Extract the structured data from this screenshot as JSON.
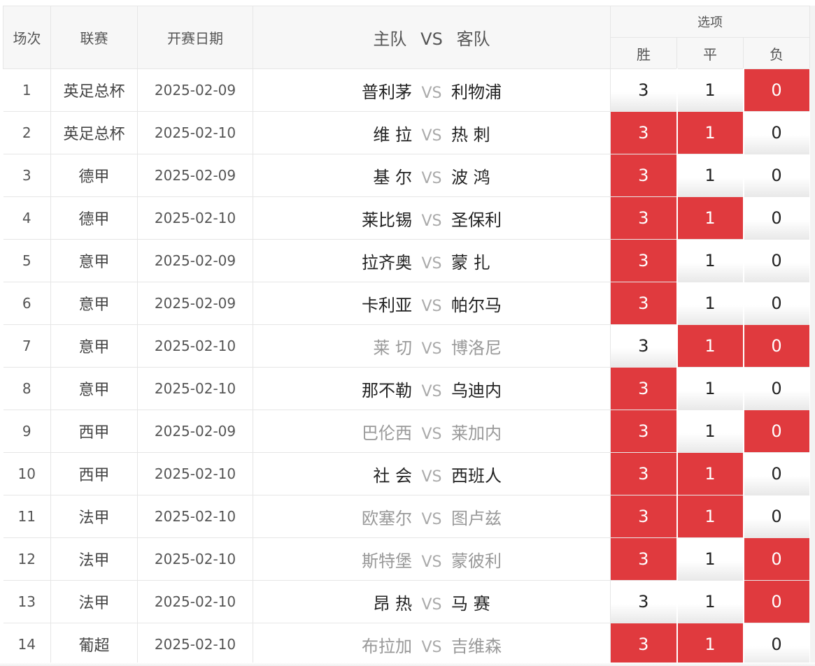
{
  "header": {
    "col_no": "场次",
    "col_league": "联赛",
    "col_date": "开赛日期",
    "col_match_home": "主队",
    "col_match_vs": "VS",
    "col_match_away": "客队",
    "col_options": "选项",
    "opt_win": "胜",
    "opt_draw": "平",
    "opt_lose": "负"
  },
  "colors": {
    "selected": "#e03a3e",
    "unselected": "#f2f2f2"
  },
  "rows": [
    {
      "no": "1",
      "league": "英足总杯",
      "date": "2025-02-09",
      "home": "普利茅",
      "vs": "VS",
      "away": "利物浦",
      "win": "3",
      "draw": "1",
      "lose": "0",
      "win_on": false,
      "draw_on": false,
      "lose_on": true,
      "dim": false
    },
    {
      "no": "2",
      "league": "英足总杯",
      "date": "2025-02-10",
      "home": "维 拉",
      "vs": "VS",
      "away": "热 刺",
      "win": "3",
      "draw": "1",
      "lose": "0",
      "win_on": true,
      "draw_on": true,
      "lose_on": false,
      "dim": false
    },
    {
      "no": "3",
      "league": "德甲",
      "date": "2025-02-09",
      "home": "基 尔",
      "vs": "VS",
      "away": "波 鸿",
      "win": "3",
      "draw": "1",
      "lose": "0",
      "win_on": true,
      "draw_on": false,
      "lose_on": false,
      "dim": false
    },
    {
      "no": "4",
      "league": "德甲",
      "date": "2025-02-10",
      "home": "莱比锡",
      "vs": "VS",
      "away": "圣保利",
      "win": "3",
      "draw": "1",
      "lose": "0",
      "win_on": true,
      "draw_on": true,
      "lose_on": false,
      "dim": false
    },
    {
      "no": "5",
      "league": "意甲",
      "date": "2025-02-09",
      "home": "拉齐奥",
      "vs": "VS",
      "away": "蒙 扎",
      "win": "3",
      "draw": "1",
      "lose": "0",
      "win_on": true,
      "draw_on": false,
      "lose_on": false,
      "dim": false
    },
    {
      "no": "6",
      "league": "意甲",
      "date": "2025-02-09",
      "home": "卡利亚",
      "vs": "VS",
      "away": "帕尔马",
      "win": "3",
      "draw": "1",
      "lose": "0",
      "win_on": true,
      "draw_on": false,
      "lose_on": false,
      "dim": false
    },
    {
      "no": "7",
      "league": "意甲",
      "date": "2025-02-10",
      "home": "莱 切",
      "vs": "VS",
      "away": "博洛尼",
      "win": "3",
      "draw": "1",
      "lose": "0",
      "win_on": false,
      "draw_on": true,
      "lose_on": true,
      "dim": true
    },
    {
      "no": "8",
      "league": "意甲",
      "date": "2025-02-10",
      "home": "那不勒",
      "vs": "VS",
      "away": "乌迪内",
      "win": "3",
      "draw": "1",
      "lose": "0",
      "win_on": true,
      "draw_on": false,
      "lose_on": false,
      "dim": false
    },
    {
      "no": "9",
      "league": "西甲",
      "date": "2025-02-09",
      "home": "巴伦西",
      "vs": "VS",
      "away": "莱加内",
      "win": "3",
      "draw": "1",
      "lose": "0",
      "win_on": true,
      "draw_on": false,
      "lose_on": true,
      "dim": true
    },
    {
      "no": "10",
      "league": "西甲",
      "date": "2025-02-10",
      "home": "社 会",
      "vs": "VS",
      "away": "西班人",
      "win": "3",
      "draw": "1",
      "lose": "0",
      "win_on": true,
      "draw_on": true,
      "lose_on": false,
      "dim": false
    },
    {
      "no": "11",
      "league": "法甲",
      "date": "2025-02-10",
      "home": "欧塞尔",
      "vs": "VS",
      "away": "图卢兹",
      "win": "3",
      "draw": "1",
      "lose": "0",
      "win_on": true,
      "draw_on": true,
      "lose_on": false,
      "dim": true
    },
    {
      "no": "12",
      "league": "法甲",
      "date": "2025-02-10",
      "home": "斯特堡",
      "vs": "VS",
      "away": "蒙彼利",
      "win": "3",
      "draw": "1",
      "lose": "0",
      "win_on": true,
      "draw_on": false,
      "lose_on": true,
      "dim": true
    },
    {
      "no": "13",
      "league": "法甲",
      "date": "2025-02-10",
      "home": "昂 热",
      "vs": "VS",
      "away": "马 赛",
      "win": "3",
      "draw": "1",
      "lose": "0",
      "win_on": false,
      "draw_on": false,
      "lose_on": true,
      "dim": false
    },
    {
      "no": "14",
      "league": "葡超",
      "date": "2025-02-10",
      "home": "布拉加",
      "vs": "VS",
      "away": "吉维森",
      "win": "3",
      "draw": "1",
      "lose": "0",
      "win_on": true,
      "draw_on": true,
      "lose_on": false,
      "dim": true
    }
  ]
}
